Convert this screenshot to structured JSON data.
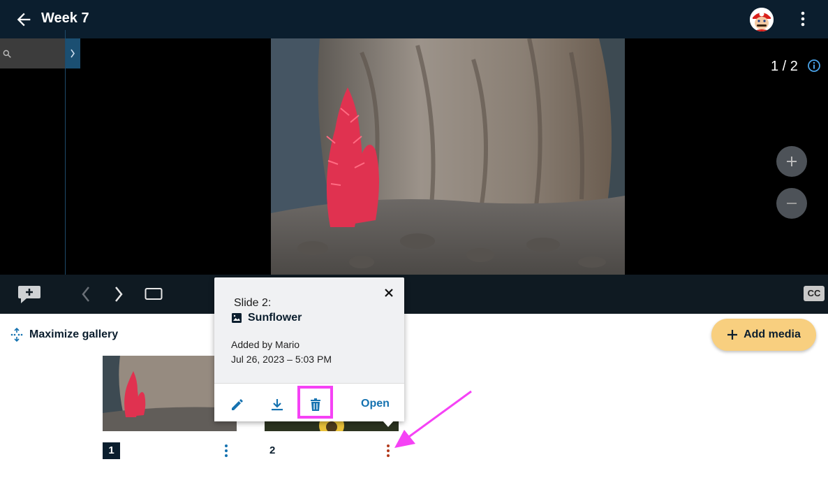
{
  "header": {
    "title": "Week 7"
  },
  "viewer": {
    "counter": "1 / 2"
  },
  "gallery": {
    "maximize_label": "Maximize gallery",
    "add_media_label": "Add media",
    "items": [
      {
        "number": "1"
      },
      {
        "number": "2"
      }
    ]
  },
  "popup": {
    "slide_label": "Slide 2:",
    "slide_name": "Sunflower",
    "added_by": "Added by Mario",
    "date": "Jul 26, 2023 – 5:03 PM",
    "open_label": "Open"
  },
  "controls": {
    "cc_label": "CC"
  },
  "colors": {
    "accent": "#1572b0",
    "highlight": "#f542f5",
    "add_media_bg": "#f8cf7f",
    "header_bg": "#0b1e2e"
  },
  "icons": [
    "back-arrow-icon",
    "avatar",
    "kebab-icon",
    "search-icon",
    "chevron-right-icon",
    "info-icon",
    "zoom-in-icon",
    "zoom-out-icon",
    "add-comment-icon",
    "chevron-left-icon",
    "slide-frame-icon",
    "closed-captions-icon",
    "maximize-icon",
    "plus-icon",
    "image-icon",
    "close-icon",
    "edit-icon",
    "download-icon",
    "trash-icon"
  ]
}
